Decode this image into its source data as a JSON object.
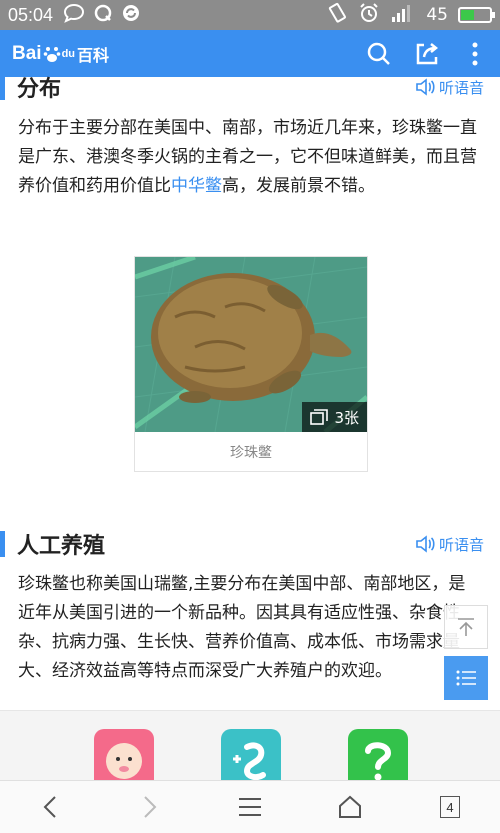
{
  "status_bar": {
    "time": "05:04",
    "battery": "45",
    "battery_level": 0.45
  },
  "header": {
    "logo_latin_1": "Bai",
    "logo_latin_2": "du",
    "logo_cn": "百科",
    "icons": [
      "search-icon",
      "share-icon",
      "more-icon"
    ]
  },
  "section1": {
    "title": "分布",
    "listen": "听语音",
    "text_before_link": "分布于主要分部在美国中、南部，市场近几年来，珍珠鳖一直是广东、港澳冬季火锅的主肴之一，它不但味道鲜美，而且营养价值和药用价值比",
    "link": "中华鳖",
    "text_after_link": "高，发展前景不错。"
  },
  "figure": {
    "count": "3张",
    "caption": "珍珠鳖"
  },
  "section2": {
    "title": "人工养殖",
    "listen": "听语音",
    "text": "珍珠鳖也称美国山瑞鳖,主要分布在美国中部、南部地区，是近年从美国引进的一个新品种。因其具有适应性强、杂食性杂、抗病力强、生长快、营养价值高、成本低、市场需求量大、经济效益高等特点而深受广大养殖户的欢迎。"
  },
  "bottom_nav": {
    "tab_count": "4"
  },
  "colors": {
    "accent": "#3a8ff0",
    "status_bar": "#8c8c8c"
  }
}
